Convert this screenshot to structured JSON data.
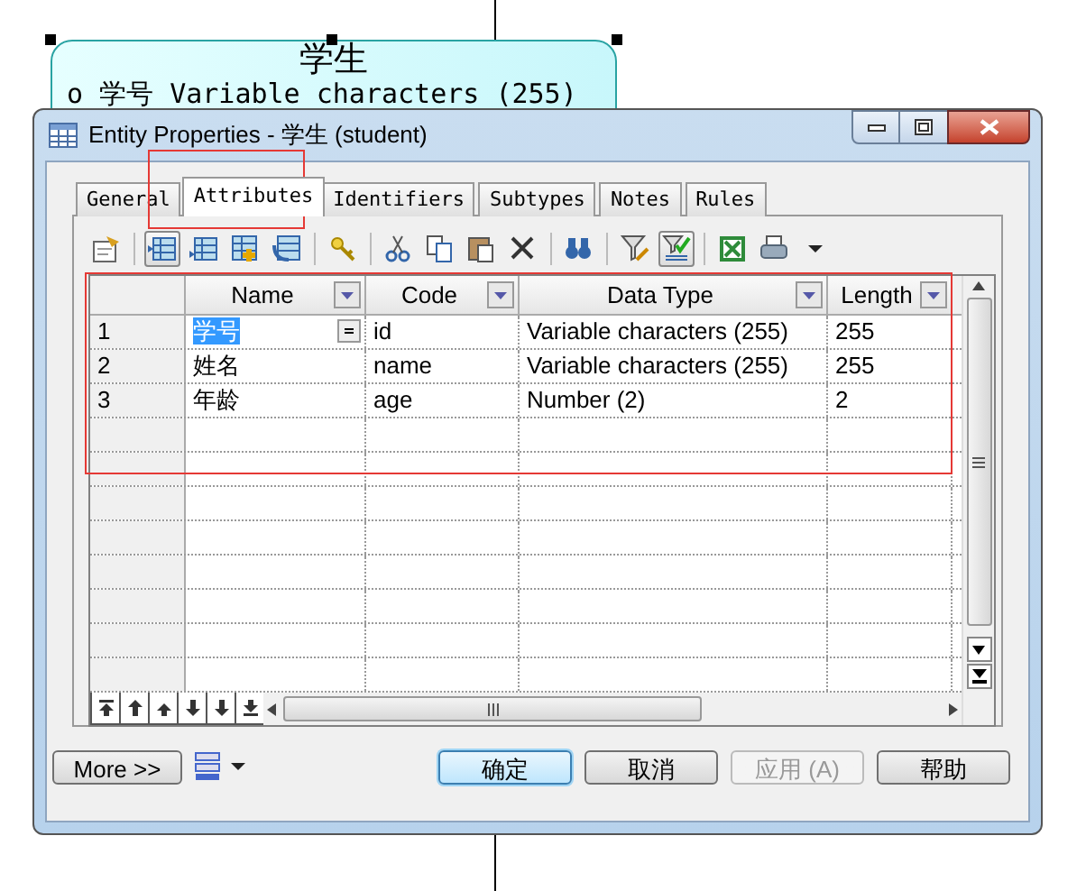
{
  "diagram": {
    "entity_title": "学生",
    "attribute_line": "o 学号 Variable characters (255)"
  },
  "window": {
    "title": "Entity Properties - 学生 (student)"
  },
  "tabs": [
    {
      "label": "General",
      "selected": false
    },
    {
      "label": "Attributes",
      "selected": true
    },
    {
      "label": "Identifiers",
      "selected": false
    },
    {
      "label": "Subtypes",
      "selected": false
    },
    {
      "label": "Notes",
      "selected": false
    },
    {
      "label": "Rules",
      "selected": false
    }
  ],
  "table": {
    "columns": [
      "Name",
      "Code",
      "Data Type",
      "Length"
    ],
    "rows": [
      {
        "number": "1",
        "selected": true,
        "cells": [
          "学号",
          "id",
          "Variable characters (255)",
          "255"
        ]
      },
      {
        "number": "2",
        "selected": false,
        "cells": [
          "姓名",
          "name",
          "Variable characters (255)",
          "255"
        ]
      },
      {
        "number": "3",
        "selected": false,
        "cells": [
          "年龄",
          "age",
          "Number (2)",
          "2"
        ]
      }
    ]
  },
  "buttons": [
    {
      "label": "More >>",
      "kind": "more",
      "disabled": false,
      "default": false
    },
    {
      "label": "确定",
      "kind": "action",
      "disabled": false,
      "default": true
    },
    {
      "label": "取消",
      "kind": "action",
      "disabled": false,
      "default": false
    },
    {
      "label": "应用 (A)",
      "kind": "action",
      "disabled": true,
      "default": false
    },
    {
      "label": "帮助",
      "kind": "action",
      "disabled": false,
      "default": false
    }
  ]
}
